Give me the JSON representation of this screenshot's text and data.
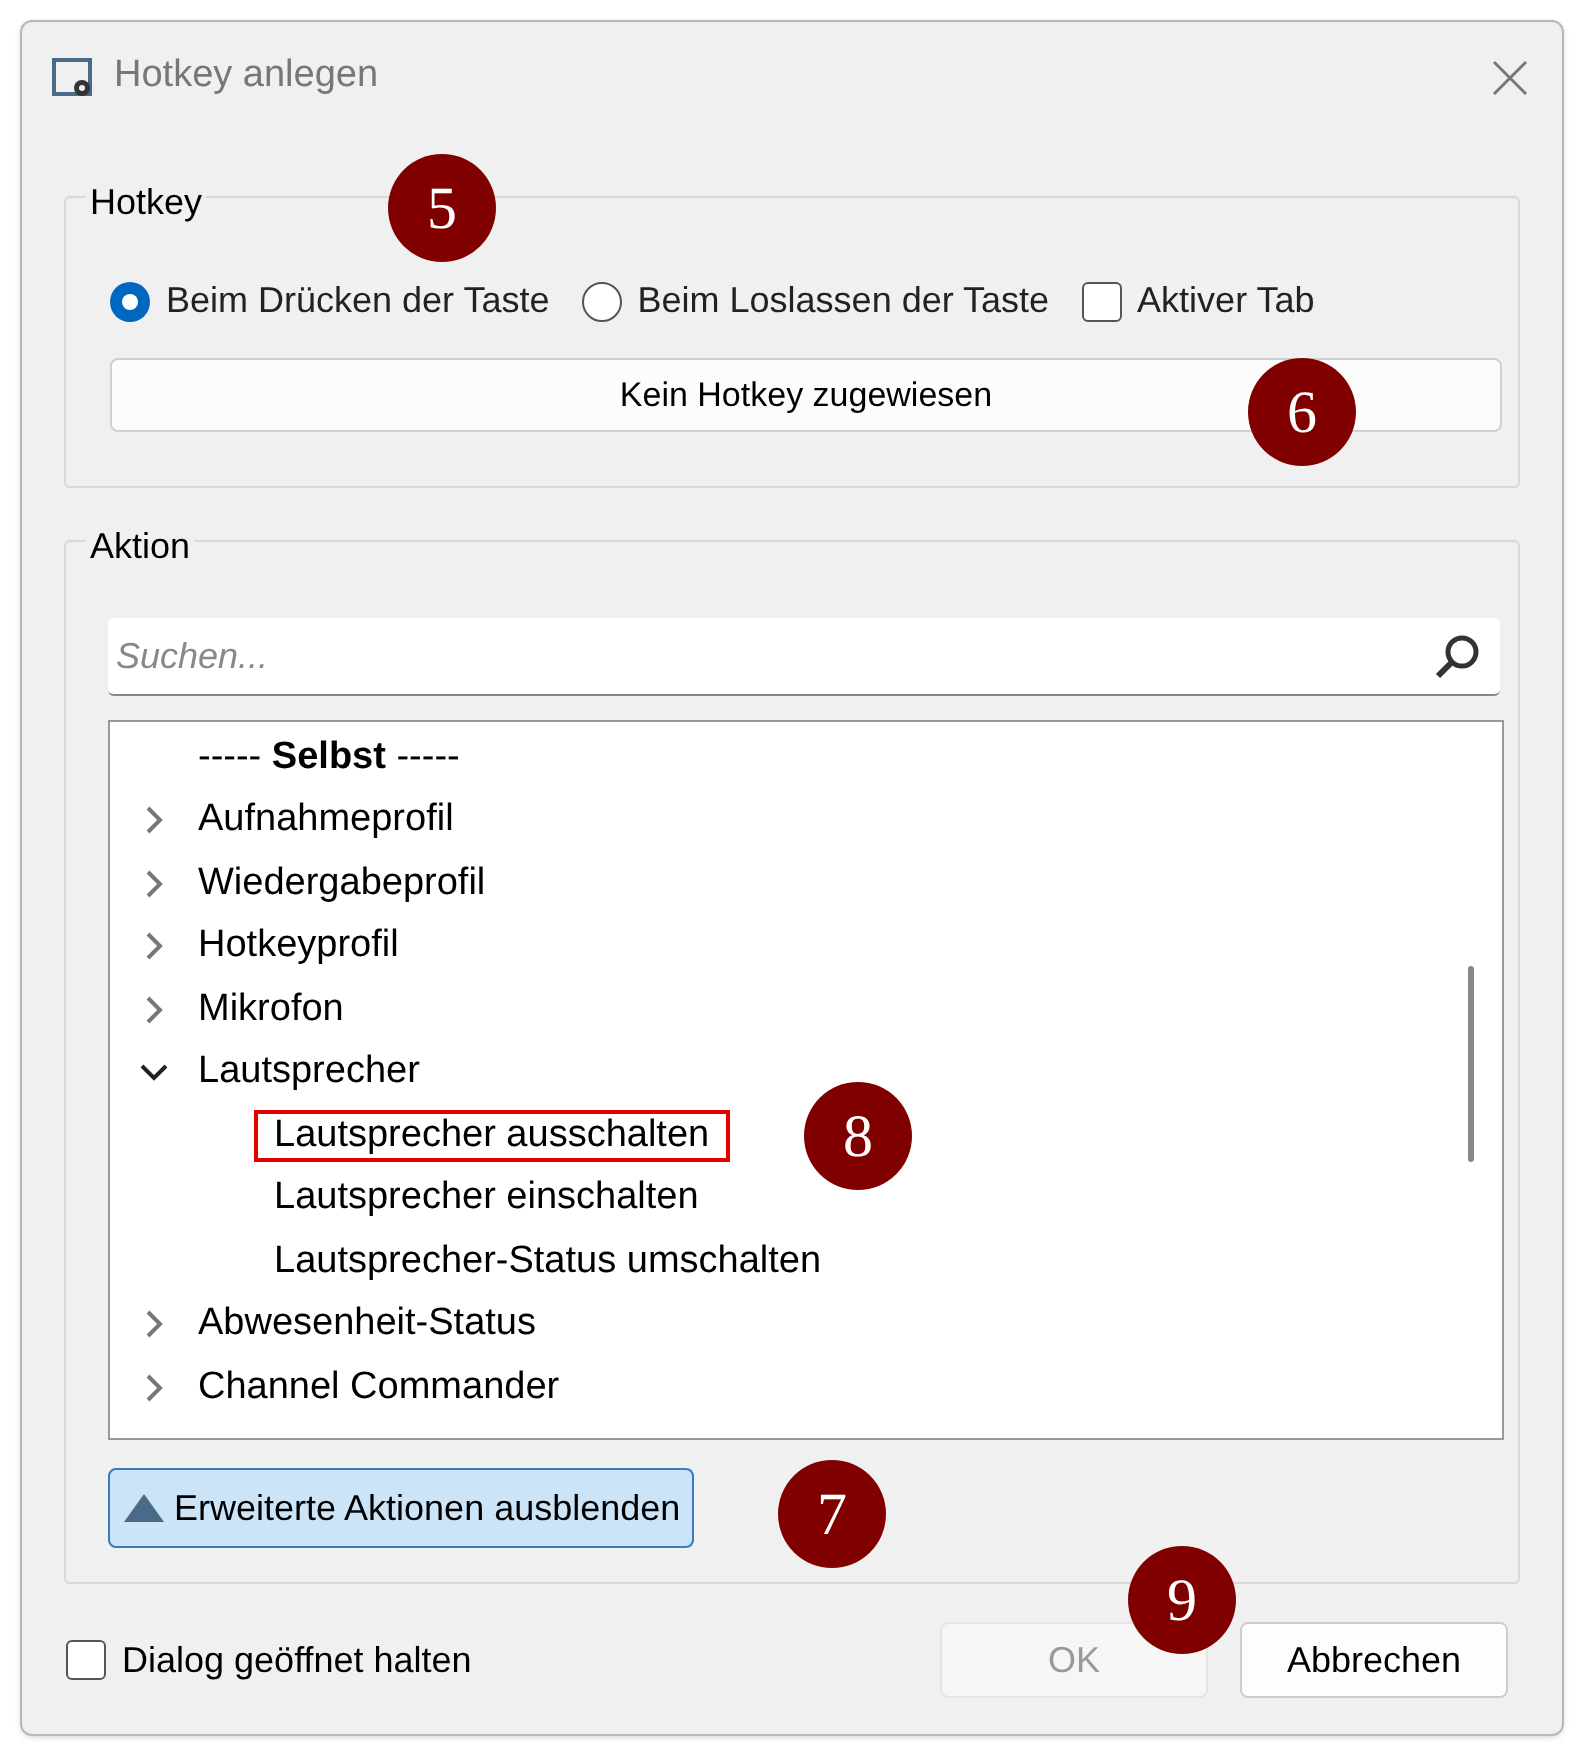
{
  "window": {
    "title": "Hotkey anlegen"
  },
  "hotkey_group": {
    "title": "Hotkey",
    "options": [
      {
        "kind": "radio",
        "label": "Beim Drücken der Taste",
        "selected": true
      },
      {
        "kind": "radio",
        "label": "Beim Loslassen der Taste",
        "selected": false
      },
      {
        "kind": "checkbox",
        "label": "Aktiver Tab",
        "checked": false
      }
    ],
    "assign_button": "Kein Hotkey zugewiesen"
  },
  "action_group": {
    "title": "Aktion",
    "search": {
      "placeholder": "Suchen..."
    },
    "tree": [
      {
        "kind": "header",
        "label": "----- **Selbst** -----"
      },
      {
        "kind": "node",
        "label": "Aufnahmeprofil",
        "expanded": false
      },
      {
        "kind": "node",
        "label": "Wiedergabeprofil",
        "expanded": false
      },
      {
        "kind": "node",
        "label": "Hotkeyprofil",
        "expanded": false
      },
      {
        "kind": "node",
        "label": "Mikrofon",
        "expanded": false
      },
      {
        "kind": "node",
        "label": "Lautsprecher",
        "expanded": true,
        "children": [
          {
            "kind": "leaf",
            "label": "Lautsprecher ausschalten",
            "highlighted": true
          },
          {
            "kind": "leaf",
            "label": "Lautsprecher einschalten",
            "highlighted": false
          },
          {
            "kind": "leaf",
            "label": "Lautsprecher-Status umschalten",
            "highlighted": false
          }
        ]
      },
      {
        "kind": "node",
        "label": "Abwesenheit-Status",
        "expanded": false
      },
      {
        "kind": "node",
        "label": "Channel Commander",
        "expanded": false
      }
    ],
    "toggle_button": "Erweiterte Aktionen ausblenden"
  },
  "footer": {
    "keep_open": {
      "label": "Dialog geöffnet halten",
      "checked": false
    },
    "buttons": [
      {
        "label": "OK",
        "disabled": true
      },
      {
        "label": "Abbrechen",
        "disabled": false
      }
    ]
  },
  "callouts": [
    "5",
    "6",
    "7",
    "8",
    "9"
  ]
}
